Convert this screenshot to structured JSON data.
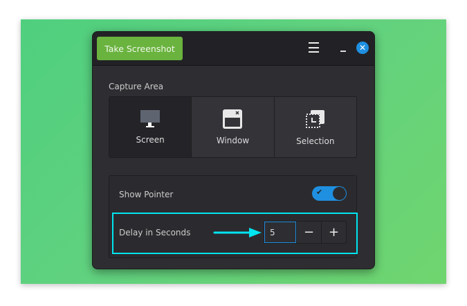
{
  "header": {
    "take_screenshot": "Take Screenshot"
  },
  "capture": {
    "label": "Capture Area",
    "options": [
      {
        "label": "Screen",
        "selected": true
      },
      {
        "label": "Window"
      },
      {
        "label": "Selection"
      }
    ]
  },
  "settings": {
    "show_pointer": "Show Pointer",
    "show_pointer_on": true,
    "delay_label": "Delay in Seconds",
    "delay_value": "5",
    "minus": "−",
    "plus": "+"
  },
  "colors": {
    "accent": "#1f8fe0",
    "button": "#6ab33f",
    "highlight": "#00e5f0"
  }
}
